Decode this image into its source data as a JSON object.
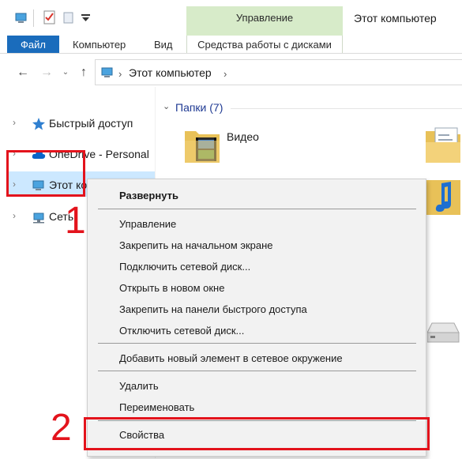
{
  "ribbon": {
    "context_group": "Управление",
    "window_title": "Этот компьютер",
    "tabs": {
      "file": "Файл",
      "computer": "Компьютер",
      "view": "Вид",
      "disk_tools": "Средства работы с дисками"
    }
  },
  "address": {
    "path": "Этот компьютер"
  },
  "nav_pane": {
    "items": [
      {
        "label": "Быстрый доступ",
        "icon": "star-icon"
      },
      {
        "label": "OneDrive - Personal",
        "icon": "cloud-icon"
      },
      {
        "label": "Этот ко",
        "icon": "computer-icon"
      },
      {
        "label": "Сеть",
        "icon": "network-icon"
      }
    ]
  },
  "content": {
    "group_header": "Папки (7)",
    "folders": [
      {
        "label": "Видео"
      }
    ]
  },
  "context_menu": {
    "items": [
      "Развернуть",
      "Управление",
      "Закрепить на начальном экране",
      "Подключить сетевой диск...",
      "Открыть в новом окне",
      "Закрепить на панели быстрого доступа",
      "Отключить сетевой диск...",
      "Добавить новый элемент в сетевое окружение",
      "Удалить",
      "Переименовать",
      "Свойства"
    ]
  },
  "annotations": {
    "step1": "1",
    "step2": "2"
  },
  "colors": {
    "accent_blue": "#1a6cbc",
    "selection": "#cce8ff",
    "context_tab_green": "#d7ebc9",
    "annotation_red": "#e3131c"
  }
}
